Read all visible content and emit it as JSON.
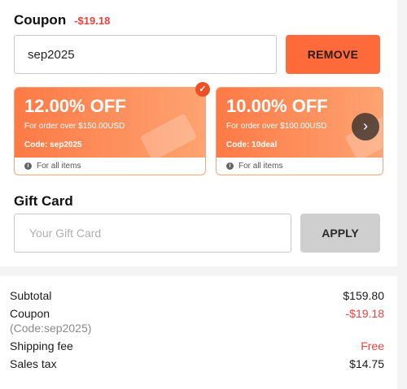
{
  "coupon": {
    "title": "Coupon",
    "discount": "-$19.18",
    "input_value": "sep2025",
    "remove_label": "REMOVE",
    "cards": [
      {
        "off": "12.00% OFF",
        "min": "For order over $150.00USD",
        "code": "Code: sep2025",
        "scope": "For all items",
        "selected": true
      },
      {
        "off": "10.00% OFF",
        "min": "For order over $100.00USD",
        "code": "Code: 10deal",
        "scope": "For all items",
        "selected": false
      }
    ]
  },
  "gift_card": {
    "title": "Gift Card",
    "placeholder": "Your Gift Card",
    "apply_label": "APPLY"
  },
  "summary": {
    "subtotal_label": "Subtotal",
    "subtotal_value": "$159.80",
    "coupon_label": "Coupon",
    "coupon_value": "-$19.18",
    "coupon_code_note": "(Code:sep2025)",
    "shipping_label": "Shipping fee",
    "shipping_value": "Free",
    "tax_label": "Sales tax",
    "tax_value": "$14.75"
  },
  "colors": {
    "accent": "#fe6a3a",
    "discount_red": "#e9413d"
  },
  "icons": {
    "selected": "check-icon",
    "next": "chevron-right-icon",
    "info": "info-icon"
  }
}
